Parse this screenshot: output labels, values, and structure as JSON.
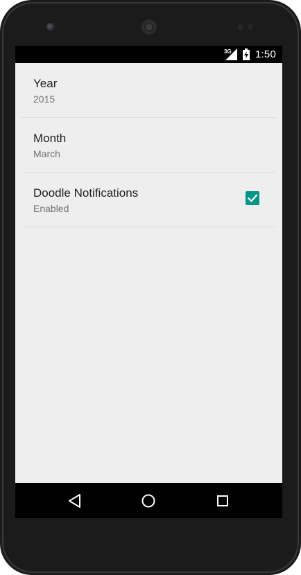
{
  "status_bar": {
    "network_label": "3G",
    "time": "1:50",
    "signal_icon": "signal-icon",
    "battery_icon": "battery-icon"
  },
  "preferences": [
    {
      "title": "Year",
      "summary": "2015"
    },
    {
      "title": "Month",
      "summary": "March"
    },
    {
      "title": "Doodle Notifications",
      "summary": "Enabled",
      "checked": true
    }
  ],
  "colors": {
    "accent": "#009688",
    "background": "#eeeeee",
    "status_bar": "#000000",
    "nav_bar": "#000000"
  },
  "nav_bar": {
    "back_icon": "back-triangle-icon",
    "home_icon": "home-circle-icon",
    "recents_icon": "recents-square-icon"
  }
}
